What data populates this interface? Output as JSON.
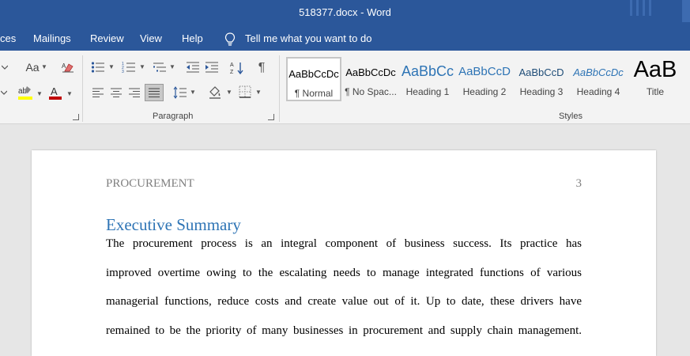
{
  "titlebar": {
    "title": "518377.docx - Word"
  },
  "menu": {
    "references_partial": "ces",
    "mailings": "Mailings",
    "review": "Review",
    "view": "View",
    "help": "Help",
    "tell_me": "Tell me what you want to do"
  },
  "ribbon": {
    "font_size_label": "Aa",
    "paragraph_label": "Paragraph",
    "pilcrow": "¶",
    "styles_label": "Styles",
    "styles": [
      {
        "sample": "AaBbCcDc",
        "name": "¶ Normal"
      },
      {
        "sample": "AaBbCcDc",
        "name": "¶ No Spac..."
      },
      {
        "sample": "AaBbCc",
        "name": "Heading 1"
      },
      {
        "sample": "AaBbCcD",
        "name": "Heading 2"
      },
      {
        "sample": "AaBbCcD",
        "name": "Heading 3"
      },
      {
        "sample": "AaBbCcDc",
        "name": "Heading 4"
      },
      {
        "sample": "AaB",
        "name": "Title"
      }
    ],
    "colors": {
      "highlight": "#ffff00",
      "font_color": "#c00000"
    }
  },
  "document": {
    "header_text": "PROCUREMENT",
    "page_number": "3",
    "heading": "Executive Summary",
    "lines": [
      "The procurement process is an integral component of business success. Its practice has",
      "improved overtime owing to the escalating needs to manage integrated functions of various",
      "managerial functions, reduce costs and create value out of it. Up to date, these drivers have",
      "remained to be the priority of many businesses in procurement and supply chain management."
    ]
  },
  "theme": {
    "titlebar": "#2b579a",
    "heading_color": "#2e74b5"
  }
}
